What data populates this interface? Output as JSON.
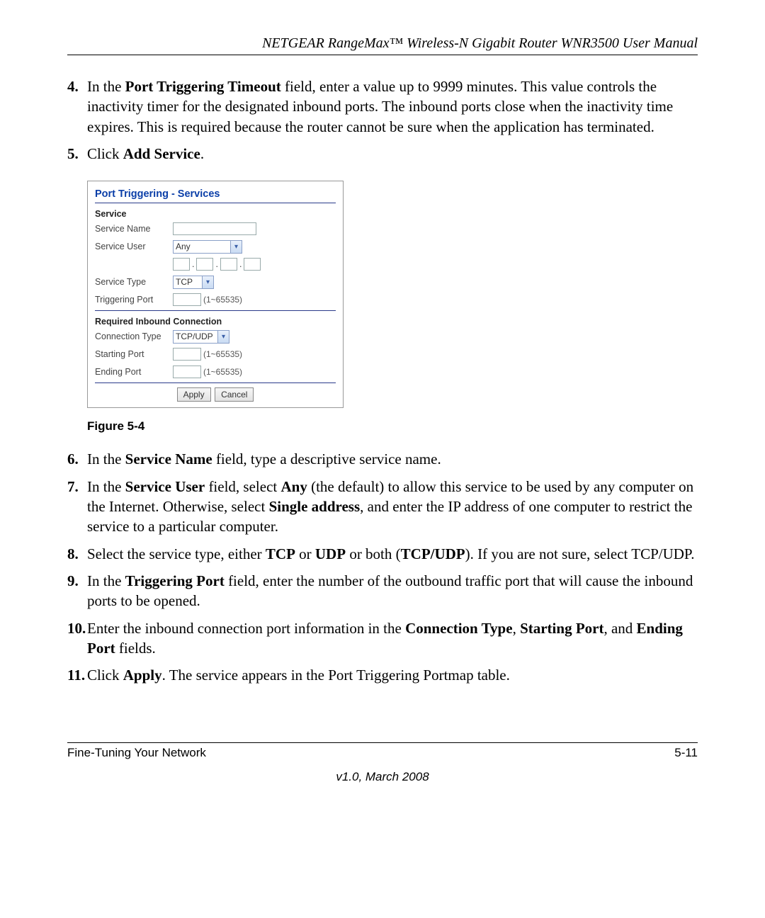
{
  "header": {
    "running_head": "NETGEAR RangeMax™ Wireless-N Gigabit Router WNR3500 User Manual"
  },
  "steps": {
    "s4": {
      "num": "4.",
      "pre": "In the ",
      "b1": "Port Triggering Timeout",
      "post": " field, enter a value up to 9999 minutes. This value controls the inactivity timer for the designated inbound ports. The inbound ports close when the inactivity time expires. This is required because the router cannot be sure when the application has terminated."
    },
    "s5": {
      "num": "5.",
      "pre": "Click ",
      "b1": "Add Service",
      "post": "."
    },
    "s6": {
      "num": "6.",
      "pre": "In the ",
      "b1": "Service Name",
      "post": " field, type a descriptive service name."
    },
    "s7": {
      "num": "7.",
      "pre": "In the ",
      "b1": "Service User",
      "mid1": " field, select ",
      "b2": "Any",
      "mid2": " (the default) to allow this service to be used by any computer on the Internet. Otherwise, select ",
      "b3": "Single address",
      "post": ", and enter the IP address of one computer to restrict the service to a particular computer."
    },
    "s8": {
      "num": "8.",
      "pre": "Select the service type, either ",
      "b1": "TCP",
      "mid1": " or ",
      "b2": "UDP",
      "mid2": " or both (",
      "b3": "TCP/UDP",
      "post": "). If you are not sure, select TCP/UDP."
    },
    "s9": {
      "num": "9.",
      "pre": "In the ",
      "b1": "Triggering Port",
      "post": " field, enter the number of the outbound traffic port that will cause the inbound ports to be opened."
    },
    "s10": {
      "num": "10.",
      "pre": "Enter the inbound connection port information in the ",
      "b1": "Connection Type",
      "mid1": ", ",
      "b2": "Starting Port",
      "mid2": ", and ",
      "b3": "Ending Port",
      "post": " fields."
    },
    "s11": {
      "num": "11.",
      "pre": "Click ",
      "b1": "Apply",
      "post": ". The service appears in the Port Triggering Portmap table."
    }
  },
  "figure": {
    "caption": "Figure 5-4",
    "panel_title": "Port Triggering - Services",
    "service_section": "Service",
    "labels": {
      "service_name": "Service Name",
      "service_user": "Service User",
      "service_type": "Service Type",
      "triggering_port": "Triggering Port",
      "inbound_section": "Required Inbound Connection",
      "connection_type": "Connection Type",
      "starting_port": "Starting Port",
      "ending_port": "Ending Port"
    },
    "values": {
      "service_user": "Any",
      "service_type": "TCP",
      "connection_type": "TCP/UDP",
      "range_hint": "(1~65535)"
    },
    "buttons": {
      "apply": "Apply",
      "cancel": "Cancel"
    }
  },
  "footer": {
    "left": "Fine-Tuning Your Network",
    "right": "5-11",
    "version": "v1.0, March 2008"
  }
}
